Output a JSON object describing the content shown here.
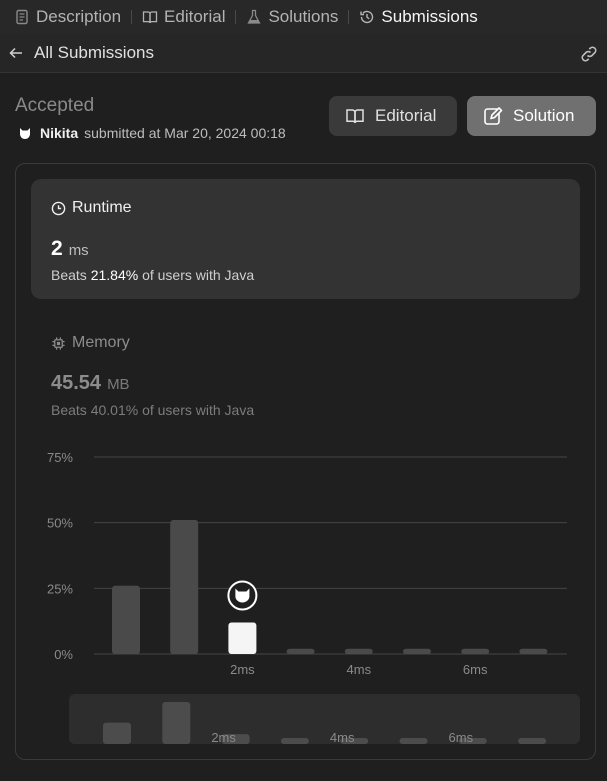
{
  "tabs": [
    {
      "label": "Description",
      "icon": "description-icon",
      "active": false
    },
    {
      "label": "Editorial",
      "icon": "book-icon",
      "active": false
    },
    {
      "label": "Solutions",
      "icon": "flask-icon",
      "active": false
    },
    {
      "label": "Submissions",
      "icon": "history-icon",
      "active": true
    }
  ],
  "subheader": {
    "back_label": "All Submissions"
  },
  "submission": {
    "status": "Accepted",
    "user": "Nikita",
    "submitted_text": "submitted at Mar 20, 2024 00:18"
  },
  "buttons": {
    "editorial": "Editorial",
    "solution": "Solution"
  },
  "runtime": {
    "title": "Runtime",
    "value": "2",
    "unit": "ms",
    "beats_prefix": "Beats",
    "beats_pct": "21.84%",
    "beats_suffix": "of users with Java"
  },
  "memory": {
    "title": "Memory",
    "value": "45.54",
    "unit": "MB",
    "beats_prefix": "Beats",
    "beats_pct": "40.01%",
    "beats_suffix": "of users with Java"
  },
  "colors": {
    "background": "#1f1f1f",
    "card": "#333333",
    "bar": "#4a4a4a",
    "bar_highlight": "#f5f5f5"
  },
  "chart_data": {
    "type": "bar",
    "y_tick_labels": [
      "0%",
      "25%",
      "50%",
      "75%"
    ],
    "ylim": [
      0,
      75
    ],
    "x_tick_labels": [
      "2ms",
      "4ms",
      "6ms"
    ],
    "values": [
      26,
      51,
      12,
      2,
      2,
      2,
      2,
      2
    ],
    "highlight_index": 2,
    "grid": true
  },
  "navigator": {
    "values": [
      26,
      51,
      12,
      2,
      2,
      2,
      2,
      2
    ],
    "x_tick_labels": [
      "2ms",
      "4ms",
      "6ms"
    ]
  }
}
